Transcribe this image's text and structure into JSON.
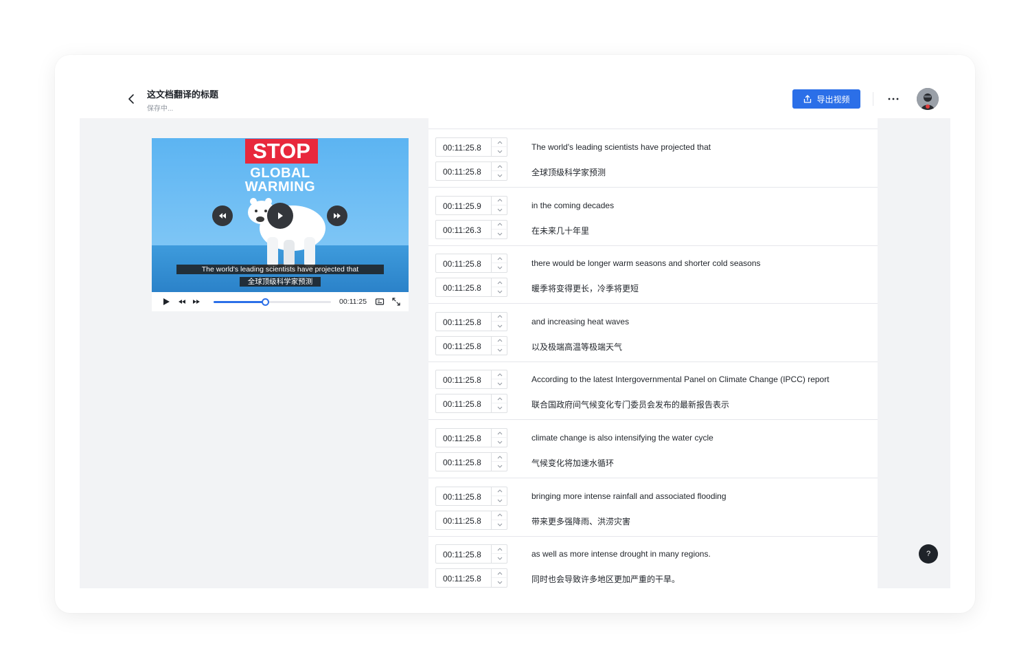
{
  "header": {
    "title": "这文档翻译的标题",
    "status": "保存中...",
    "export_label": "导出视频"
  },
  "video": {
    "overlay_stop": "STOP",
    "overlay_line1": "GLOBAL",
    "overlay_line2": "WARMING",
    "subtitle_en": "The world's leading scientists have projected that",
    "subtitle_zh": "全球顶级科学家预测",
    "current_time": "00:11:25",
    "progress_percent": 44
  },
  "segments": [
    {
      "en_time": "00:11:25.8",
      "en": "The world's leading scientists have projected that",
      "zh_time": "00:11:25.8",
      "zh": "全球顶级科学家预测"
    },
    {
      "en_time": "00:11:25.9",
      "en": " in the coming decades",
      "zh_time": "00:11:26.3",
      "zh": "在未来几十年里"
    },
    {
      "en_time": "00:11:25.8",
      "en": "there would be longer warm seasons and shorter cold seasons",
      "zh_time": "00:11:25.8",
      "zh": "暖季将变得更长，冷季将更短"
    },
    {
      "en_time": "00:11:25.8",
      "en": "and increasing heat waves",
      "zh_time": "00:11:25.8",
      "zh": "以及极端高温等极端天气"
    },
    {
      "en_time": "00:11:25.8",
      "en": "According to the latest Intergovernmental Panel on Climate Change (IPCC) report",
      "zh_time": "00:11:25.8",
      "zh": "联合国政府间气候变化专门委员会发布的最新报告表示"
    },
    {
      "en_time": "00:11:25.8",
      "en": "climate change is also intensifying the water cycle",
      "zh_time": "00:11:25.8",
      "zh": "气候变化将加速水循环"
    },
    {
      "en_time": "00:11:25.8",
      "en": "bringing more intense rainfall and associated flooding",
      "zh_time": "00:11:25.8",
      "zh": "带来更多强降雨、洪涝灾害"
    },
    {
      "en_time": "00:11:25.8",
      "en": "as well as more intense drought in many regions.",
      "zh_time": "00:11:25.8",
      "zh": "同时也会导致许多地区更加严重的干旱。"
    }
  ],
  "help_label": "?",
  "colors": {
    "accent": "#2b6fe8",
    "stop_red": "#e8283c",
    "sky": "#5cb4f2"
  },
  "icons": [
    "back-icon",
    "export-icon",
    "more-icon",
    "play-icon",
    "rewind-icon",
    "forward-icon",
    "caption-icon",
    "fullscreen-icon",
    "chevron-up-icon",
    "chevron-down-icon"
  ]
}
